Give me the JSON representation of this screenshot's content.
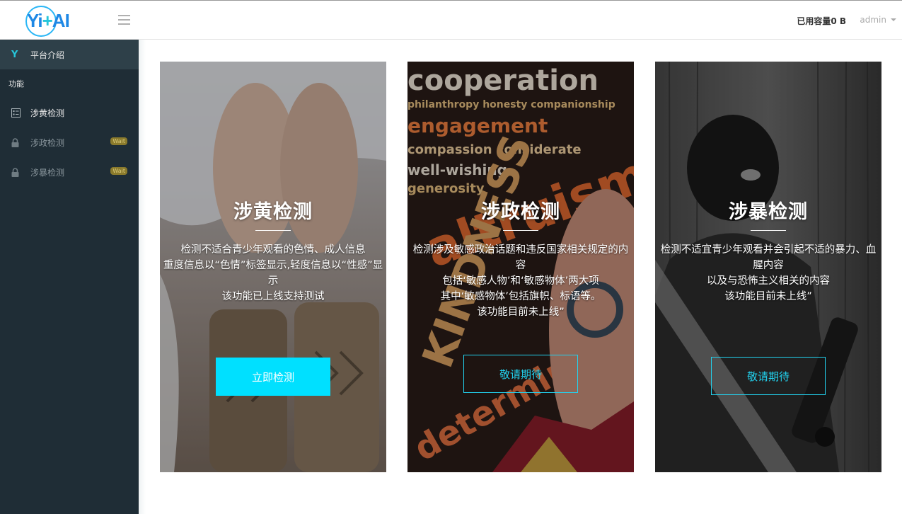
{
  "header": {
    "logo_text_left": "Yi",
    "logo_text_plus": "+",
    "logo_text_right": "AI",
    "capacity_label": "已用容量0 B",
    "user_name": "admin"
  },
  "sidebar": {
    "intro": {
      "icon": "Y",
      "label": "平台介绍"
    },
    "section_label": "功能",
    "items": [
      {
        "label": "涉黄检测",
        "icon": "grid-icon",
        "badge": ""
      },
      {
        "label": "涉政检测",
        "icon": "lock-icon",
        "badge": "Wait"
      },
      {
        "label": "涉暴检测",
        "icon": "lock-icon",
        "badge": "Wait"
      }
    ]
  },
  "cards": [
    {
      "title": "涉黄检测",
      "desc": [
        "检测不适合青少年观看的色情、成人信息",
        "重度信息以“色情”标签显示,轻度信息以“性感”显",
        "示",
        "该功能已上线支持测试"
      ],
      "button": "立即检测"
    },
    {
      "title": "涉政检测",
      "desc": [
        "检测涉及敏感政治话题和违反国家相关规定的内",
        "容",
        "包括‘敏感人物’和‘敏感物体’两大项",
        "其中‘敏感物体’包括旗帜、标语等。",
        "该功能目前未上线”"
      ],
      "button": "敬请期待"
    },
    {
      "title": "涉暴检测",
      "desc": [
        "检测不适宜青少年观看并会引起不适的暴力、血",
        "腥内容",
        "以及与恐怖主义相关的内容",
        "该功能目前未上线”"
      ],
      "button": "敬请期待"
    }
  ],
  "colors": {
    "accent": "#00e0ff",
    "sidebar_bg": "#1f2d36",
    "sidebar_active": "#2e4049",
    "badge": "#8a7a2c"
  },
  "card_backgrounds": {
    "first": "photo-bed-boots",
    "second": "word-cloud-collage",
    "third": "masked-person-bw"
  }
}
